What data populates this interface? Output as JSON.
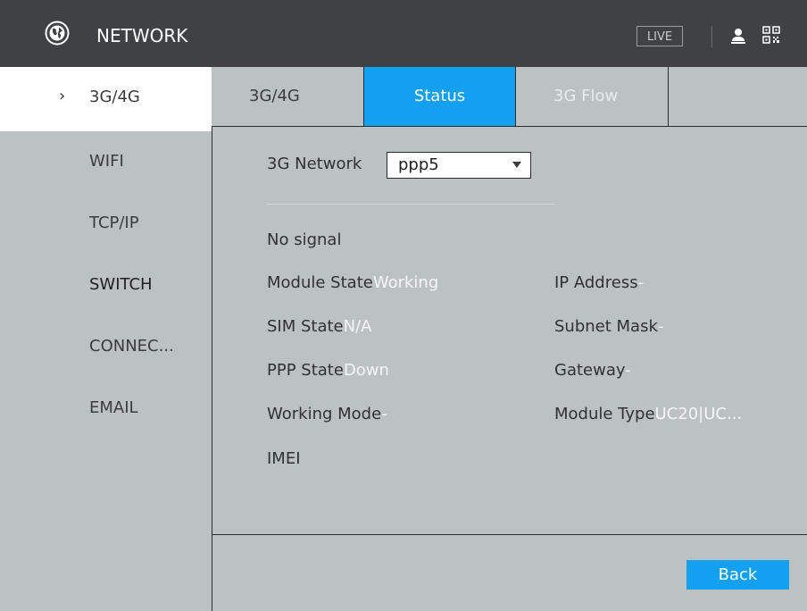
{
  "header": {
    "title": "NETWORK",
    "live_label": "LIVE",
    "icons": [
      "globe-icon",
      "user-icon",
      "qr-code-icon"
    ]
  },
  "sidebar": {
    "items": [
      {
        "label": "3G/4G",
        "active": true
      },
      {
        "label": "WIFI"
      },
      {
        "label": "TCP/IP"
      },
      {
        "label": "SWITCH"
      },
      {
        "label": "CONNEC..."
      },
      {
        "label": "EMAIL"
      }
    ]
  },
  "tabs": [
    {
      "label": "3G/4G"
    },
    {
      "label": "Status",
      "active": true
    },
    {
      "label": "3G Flow"
    }
  ],
  "status": {
    "network_label": "3G Network",
    "network_value": "ppp5",
    "signal_text": "No signal",
    "module_state_label": "Module State",
    "module_state_value": "Working",
    "sim_state_label": "SIM State",
    "sim_state_value": "N/A",
    "ppp_state_label": "PPP State",
    "ppp_state_value": "Down",
    "working_mode_label": "Working Mode",
    "working_mode_value": "-",
    "imei_label": "IMEI",
    "ip_address_label": "IP Address",
    "ip_address_value": "-",
    "subnet_mask_label": "Subnet Mask",
    "subnet_mask_value": "-",
    "gateway_label": "Gateway",
    "gateway_value": "-",
    "module_type_label": "Module Type",
    "module_type_value": "UC20|UC..."
  },
  "footer": {
    "back_label": "Back"
  },
  "colors": {
    "accent": "#14a0f0",
    "titlebar": "#3f4144",
    "background": "#bcc2c2"
  }
}
